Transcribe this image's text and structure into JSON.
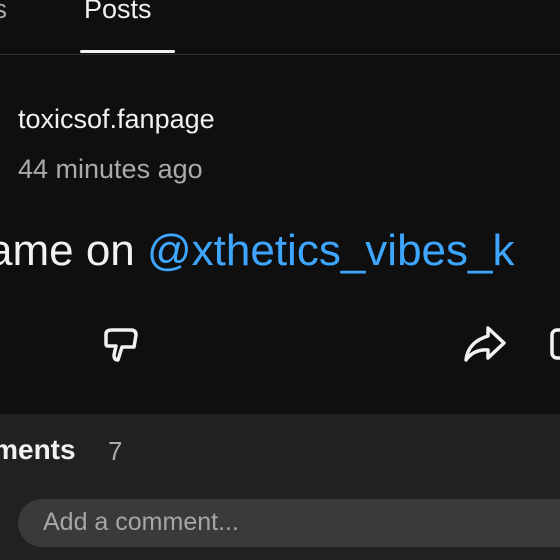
{
  "tabs": {
    "previous_label": "ts",
    "active_label": "Posts"
  },
  "post": {
    "channel": "toxicsof.fanpage",
    "time": "44 minutes ago",
    "text_prefix": "ame on ",
    "mention": "@xthetics_vibes_k"
  },
  "actions": {
    "dislike_icon": "thumbs-down-icon",
    "share_icon": "share-icon",
    "comment_icon": "comment-icon"
  },
  "comments": {
    "title": "nments",
    "count": "7",
    "placeholder": "Add a comment..."
  },
  "colors": {
    "background": "#0f0f0f",
    "panel": "#212121",
    "input": "#3a3a3a",
    "mention": "#3ea6ff",
    "secondary_text": "#aaaaaa"
  }
}
